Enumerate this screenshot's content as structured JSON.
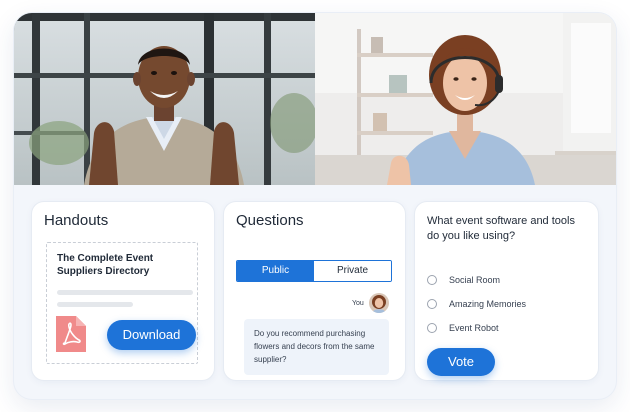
{
  "video": {
    "participants": [
      {
        "label": "participant-man"
      },
      {
        "label": "participant-woman"
      }
    ]
  },
  "handouts": {
    "title": "Handouts",
    "file_name": "The Complete Event Suppliers Directory",
    "file_icon": "pdf-icon",
    "download_label": "Download"
  },
  "questions": {
    "title": "Questions",
    "tabs": [
      {
        "label": "Public",
        "active": true
      },
      {
        "label": "Private",
        "active": false
      }
    ],
    "author_label": "You",
    "message": "Do you recommend purchasing flowers and decors from the same supplier?"
  },
  "poll": {
    "question": "What event software and tools do you like using?",
    "options": [
      {
        "label": "Social Room"
      },
      {
        "label": "Amazing Memories"
      },
      {
        "label": "Event Robot"
      }
    ],
    "vote_label": "Vote"
  },
  "colors": {
    "accent": "#1e73d8",
    "page_bg": "#f3f6fb",
    "card_bg": "#ffffff",
    "pdf_red": "#f08a8a"
  }
}
